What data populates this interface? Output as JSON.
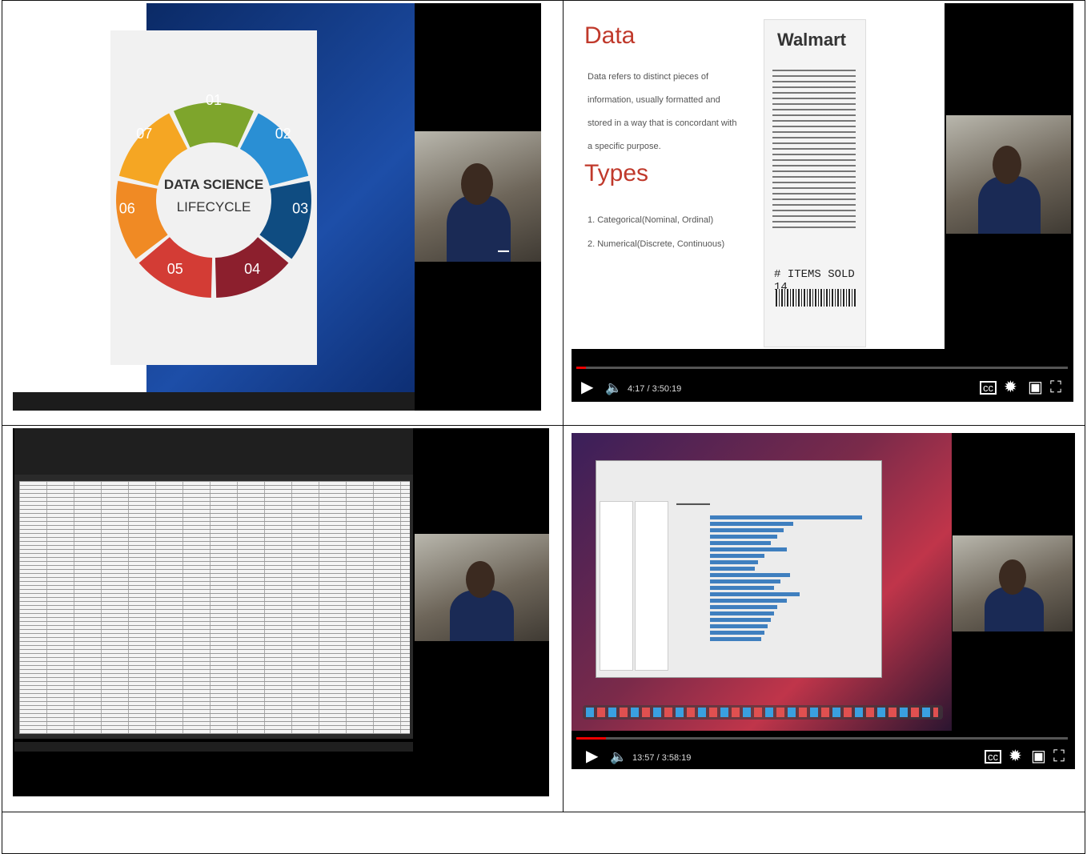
{
  "panel1": {
    "center_title_line1": "DATA SCIENCE",
    "center_title_line2": "LIFECYCLE",
    "steps": [
      {
        "num": "01",
        "color": "#7ea52c"
      },
      {
        "num": "02",
        "color": "#2a8fd4"
      },
      {
        "num": "03",
        "color": "#0f4c81"
      },
      {
        "num": "04",
        "color": "#8c1f2d"
      },
      {
        "num": "05",
        "color": "#d33c35"
      },
      {
        "num": "06",
        "color": "#f08a24"
      },
      {
        "num": "07",
        "color": "#f5a623"
      }
    ]
  },
  "panel2": {
    "title": "Data",
    "definition": "Data refers to distinct pieces of information, usually formatted and stored in a way that is concordant with a specific purpose.",
    "types_title": "Types",
    "types": [
      "1.  Categorical(Nominal, Ordinal)",
      "2.  Numerical(Discrete, Continuous)"
    ],
    "receipt_brand": "Walmart",
    "receipt_items_sold": "# ITEMS SOLD 14",
    "time": "4:17 / 3:50:19",
    "progress_fraction": 0.02
  },
  "panel4": {
    "time": "13:57 / 3:58:19",
    "progress_fraction": 0.06,
    "bars": [
      0.95,
      0.52,
      0.46,
      0.42,
      0.38,
      0.48,
      0.34,
      0.3,
      0.28,
      0.5,
      0.44,
      0.4,
      0.56,
      0.48,
      0.42,
      0.4,
      0.38,
      0.36,
      0.34,
      0.32
    ]
  },
  "icons": {
    "play": "play-icon",
    "volume": "volume-icon",
    "cc": "captions-icon",
    "settings": "settings-icon",
    "miniplayer": "miniplayer-icon",
    "fullscreen": "fullscreen-icon"
  }
}
